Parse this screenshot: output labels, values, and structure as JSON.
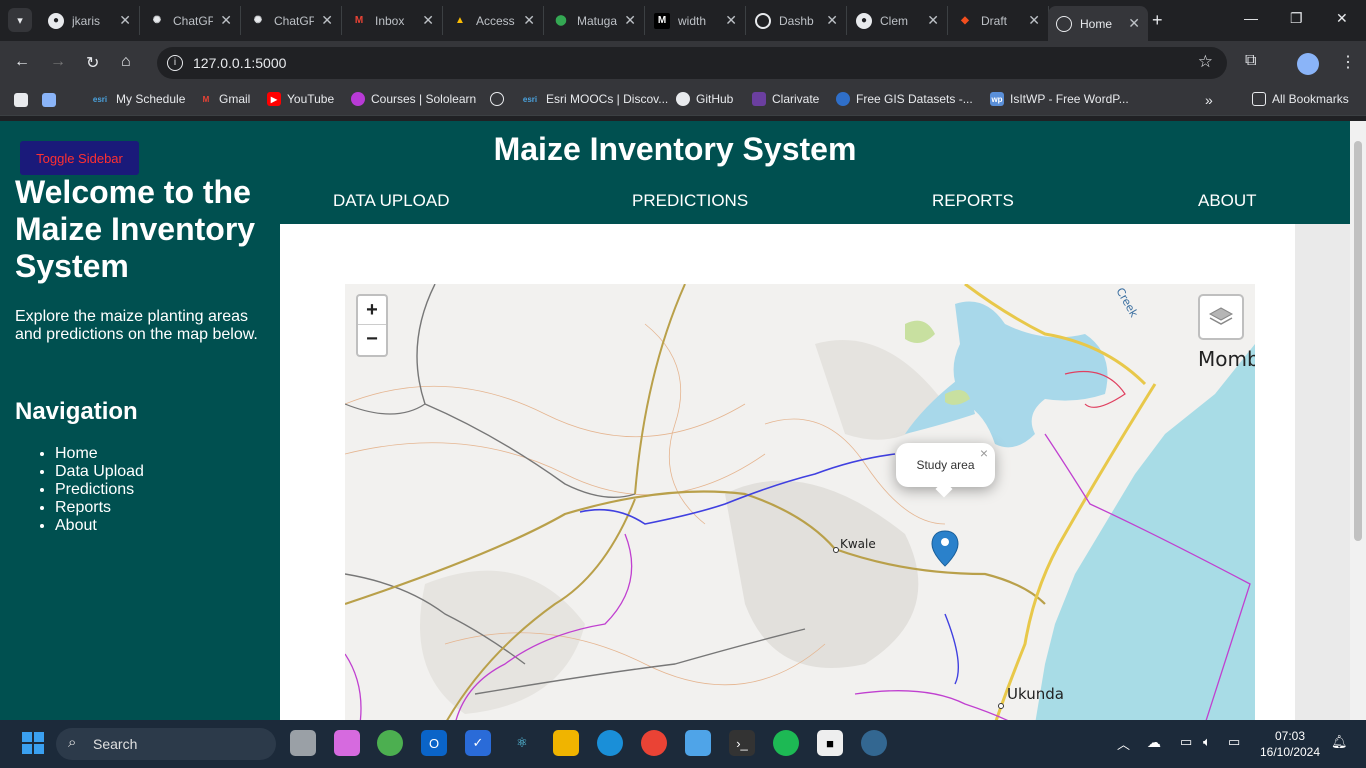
{
  "browser": {
    "tabs": [
      {
        "title": "jkaris",
        "icon": "github-icon"
      },
      {
        "title": "ChatGPT",
        "icon": "chatgpt-icon"
      },
      {
        "title": "ChatGPT",
        "icon": "chatgpt-icon"
      },
      {
        "title": "Inbox",
        "icon": "gmail-icon"
      },
      {
        "title": "Access",
        "icon": "drive-icon"
      },
      {
        "title": "Matuga",
        "icon": "maps-icon"
      },
      {
        "title": "width",
        "icon": "medium-icon"
      },
      {
        "title": "Dashb",
        "icon": "dashboard-icon"
      },
      {
        "title": "Clem",
        "icon": "github-icon"
      },
      {
        "title": "Draft",
        "icon": "figma-icon"
      },
      {
        "title": "Home",
        "icon": "globe-icon",
        "active": true
      }
    ],
    "url": "127.0.0.1:5000",
    "bookmarks": [
      {
        "label": "My Schedule",
        "icon": "esri-icon"
      },
      {
        "label": "Gmail",
        "icon": "gmail-icon"
      },
      {
        "label": "YouTube",
        "icon": "youtube-icon"
      },
      {
        "label": "Courses | Sololearn",
        "icon": "sololearn-icon"
      },
      {
        "label": "",
        "icon": "globe-icon"
      },
      {
        "label": "Esri MOOCs | Discov...",
        "icon": "esri-icon"
      },
      {
        "label": "GitHub",
        "icon": "github-icon"
      },
      {
        "label": "Clarivate",
        "icon": "clarivate-icon"
      },
      {
        "label": "Free GIS Datasets -...",
        "icon": "gis-icon"
      },
      {
        "label": "IsItWP - Free WordP...",
        "icon": "wp-icon"
      }
    ],
    "all_bookmarks_label": "All Bookmarks"
  },
  "sidebar": {
    "toggle_label": "Toggle Sidebar",
    "title": "Welcome to the Maize Inventory System",
    "description": "Explore the maize planting areas and predictions on the map below.",
    "nav_heading": "Navigation",
    "nav_items": [
      "Home",
      "Data Upload",
      "Predictions",
      "Reports",
      "About"
    ]
  },
  "header": {
    "title": "Maize Inventory System",
    "nav": [
      "DATA UPLOAD",
      "PREDICTIONS",
      "REPORTS",
      "ABOUT"
    ]
  },
  "map": {
    "zoom_in": "+",
    "zoom_out": "−",
    "popup_text": "Study area",
    "popup_close": "×",
    "labels": {
      "kwale": "Kwale",
      "ukunda": "Ukunda",
      "mombasa": "Momb",
      "creek": "Creek"
    },
    "colors": {
      "ocean": "#a8dce6",
      "land": "#f2f1ef",
      "marker": "#2a81cb",
      "boundary": "#c040d0"
    }
  },
  "taskbar": {
    "search_label": "Search",
    "time": "07:03",
    "date": "16/10/2024"
  },
  "theme": {
    "primary": "#005050",
    "toggle_bg": "#1a1a7a",
    "toggle_text": "#ff3030"
  }
}
